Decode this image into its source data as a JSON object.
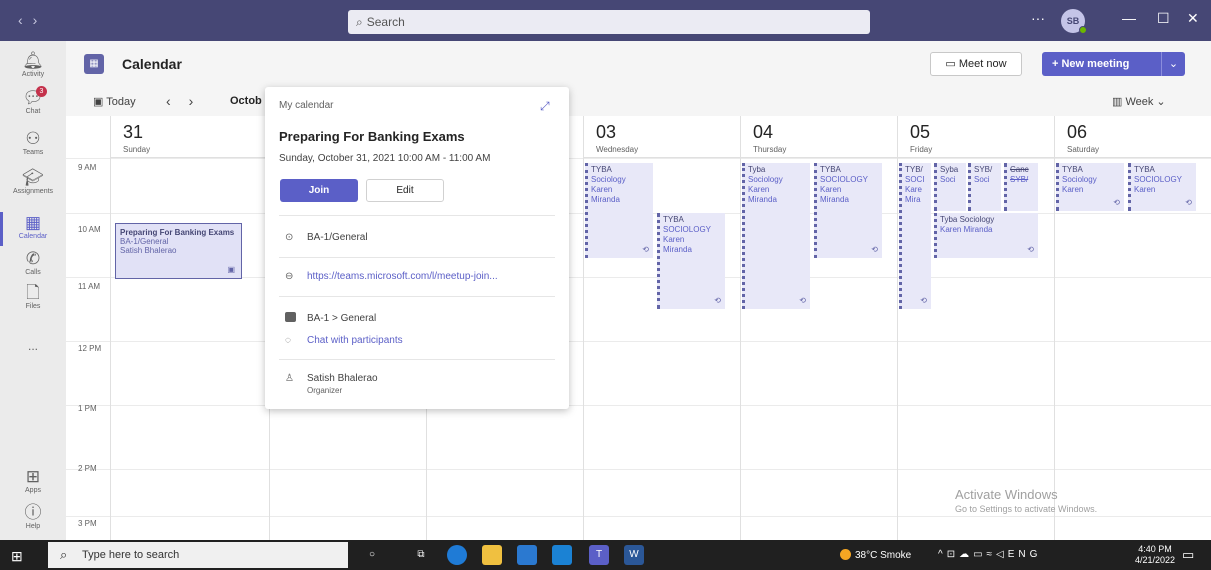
{
  "titlebar": {
    "nav_back": "‹",
    "nav_forward": "›",
    "search_placeholder": "Search",
    "more": "···",
    "avatar_initials": "SB",
    "minimize": "—",
    "maximize": "☐",
    "close": "✕"
  },
  "rail": {
    "items": [
      {
        "label": "Activity",
        "icon": "bell-icon"
      },
      {
        "label": "Chat",
        "icon": "chat-icon",
        "badge": "3"
      },
      {
        "label": "Teams",
        "icon": "teams-icon"
      },
      {
        "label": "Assignments",
        "icon": "assignments-icon"
      },
      {
        "label": "Calendar",
        "icon": "calendar-icon",
        "active": true
      },
      {
        "label": "Calls",
        "icon": "phone-icon"
      },
      {
        "label": "Files",
        "icon": "file-icon"
      },
      {
        "label": "...",
        "icon": "more-icon"
      }
    ],
    "bottom": [
      {
        "label": "Apps",
        "icon": "apps-icon"
      },
      {
        "label": "Help",
        "icon": "help-icon"
      }
    ]
  },
  "header": {
    "title": "Calendar",
    "meet_now": "Meet now",
    "new_meeting": "New meeting"
  },
  "toolbar": {
    "today": "Today",
    "month": "Octob",
    "view": "Week"
  },
  "days": [
    {
      "num": "31",
      "name": "Sunday"
    },
    {
      "num": "",
      "name": ""
    },
    {
      "num": "",
      "name": ""
    },
    {
      "num": "03",
      "name": "Wednesday"
    },
    {
      "num": "04",
      "name": "Thursday"
    },
    {
      "num": "05",
      "name": "Friday"
    },
    {
      "num": "06",
      "name": "Saturday"
    }
  ],
  "times": [
    "9 AM",
    "10 AM",
    "11 AM",
    "12 PM",
    "1 PM",
    "2 PM",
    "3 PM"
  ],
  "selected_event": {
    "title": "Preparing For Banking Exams",
    "channel": "BA-1/General",
    "organizer": "Satish Bhalerao"
  },
  "events": [
    {
      "title": "TYBA",
      "line2": "Sociology",
      "line3": "Karen",
      "line4": "Miranda"
    },
    {
      "title": "TYBA",
      "line2": "SOCIOLOGY",
      "line3": "Karen",
      "line4": "Miranda"
    },
    {
      "title": "Tyba",
      "line2": "Sociology",
      "line3": "Karen",
      "line4": "Miranda"
    },
    {
      "title": "TYBA",
      "line2": "SOCIOLOGY",
      "line3": "Karen",
      "line4": "Miranda"
    },
    {
      "title": "TYB/",
      "line2": "SOCI",
      "line3": "Kare",
      "line4": "Mira"
    },
    {
      "title": "Syba",
      "line2": "Soci"
    },
    {
      "title": "SYB/",
      "line2": "Soci"
    },
    {
      "title": "Canc",
      "line2": "SYB/"
    },
    {
      "title": "Tyba Sociology",
      "line2": "Karen Miranda"
    },
    {
      "title": "TYBA",
      "line2": "Sociology",
      "line3": "Karen"
    },
    {
      "title": "TYBA",
      "line2": "SOCIOLOGY",
      "line3": "Karen"
    }
  ],
  "popup": {
    "calendar": "My calendar",
    "title": "Preparing For Banking Exams",
    "time": "Sunday, October 31, 2021 10:00 AM - 11:00 AM",
    "join": "Join",
    "edit": "Edit",
    "location": "BA-1/General",
    "link": "https://teams.microsoft.com/l/meetup-join...",
    "channel": "BA-1 > General",
    "chat": "Chat with participants",
    "organizer": "Satish Bhalerao",
    "organizer_role": "Organizer"
  },
  "watermark": {
    "title": "Activate Windows",
    "subtitle": "Go to Settings to activate Windows."
  },
  "taskbar": {
    "search_placeholder": "Type here to search",
    "weather": "38°C  Smoke",
    "lang": "ENG",
    "time": "4:40 PM",
    "date": "4/21/2022"
  },
  "colors": {
    "titlebar": "#464775",
    "accent": "#5b5fc7",
    "event_bg": "#e8e8f8"
  }
}
